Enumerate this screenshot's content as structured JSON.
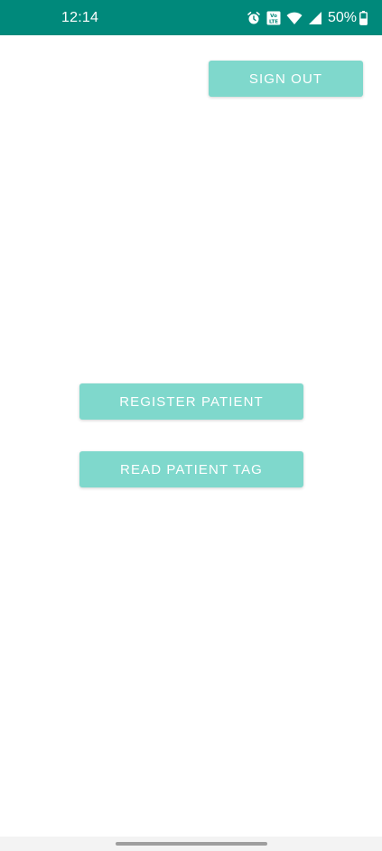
{
  "status_bar": {
    "time": "12:14",
    "battery_percent": "50%",
    "network_badge": "VoLTE",
    "icons": [
      "alarm-icon",
      "volte-icon",
      "wifi-icon",
      "signal-icon",
      "battery-icon"
    ],
    "background_color": "#00897b"
  },
  "toolbar": {
    "sign_out_label": "SIGN OUT"
  },
  "main": {
    "register_patient_label": "REGISTER PATIENT",
    "read_patient_tag_label": "READ PATIENT TAG"
  },
  "colors": {
    "button_background": "#7fd8cc",
    "button_text": "#ffffff",
    "page_background": "#ffffff"
  }
}
